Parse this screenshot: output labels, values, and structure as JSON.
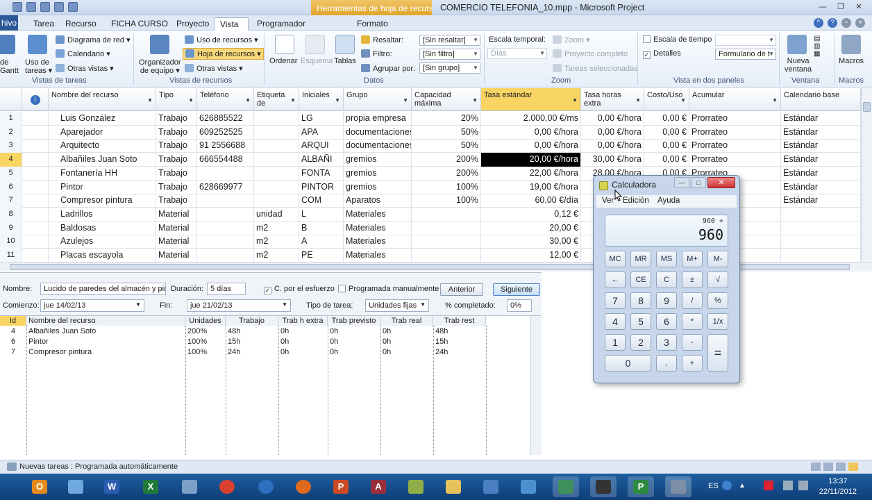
{
  "window": {
    "title": "COMERCIO TELEFONIA_10.mpp - Microsoft Project",
    "context_tab": "Herramientas de hoja de recursos"
  },
  "tabs": [
    "hivo",
    "Tarea",
    "Recurso",
    "FICHA CURSO",
    "Proyecto",
    "Vista",
    "Programador",
    "Formato"
  ],
  "ribbon": {
    "diagrama_red": "Diagrama de red",
    "calendario": "Calendario",
    "otras_vistas": "Otras vistas",
    "diagrama_gantt": "Diagrama de Gantt",
    "diagrama_l1": "de",
    "diagrama_l2": "Gantt",
    "uso_tareas_l1": "Uso de",
    "uso_tareas_l2": "tareas",
    "grp_vistas_tareas": "Vistas de tareas",
    "organizador_l1": "Organizador",
    "organizador_l2": "de equipo",
    "uso_recursos": "Uso de recursos",
    "hoja_recursos": "Hoja de recursos",
    "otras_vistas2": "Otras vistas",
    "grp_vistas_recursos": "Vistas de recursos",
    "ordenar": "Ordenar",
    "esquema": "Esquema",
    "tablas": "Tablas",
    "resaltar": "Resaltar:",
    "resaltar_val": "[Sin resaltar]",
    "filtro": "Filtro:",
    "filtro_val": "[Sin filtro]",
    "agrupar": "Agrupar por:",
    "agrupar_val": "[Sin grupo]",
    "grp_datos": "Datos",
    "escala": "Escala temporal:",
    "escala_val": "Días",
    "zoom": "Zoom",
    "proyecto_completo": "Proyecto completo",
    "tareas_sel": "Tareas seleccionadas",
    "grp_zoom": "Zoom",
    "escala_tiempo": "Escala de tiempo",
    "detalles": "Detalles",
    "formulario": "Formulario de t",
    "grp_dos_paneles": "Vista en dos paneles",
    "nueva_l1": "Nueva",
    "nueva_l2": "ventana",
    "grp_ventana": "Ventana",
    "macros": "Macros",
    "grp_macros": "Macros"
  },
  "columns": [
    "Nombre del recurso",
    "Tipo",
    "Teléfono",
    "Etiqueta de",
    "Iniciales",
    "Grupo",
    "Capacidad máxima",
    "Tasa estándar",
    "Tasa horas extra",
    "Costo/Uso",
    "Acumular",
    "Calendario base"
  ],
  "rows": [
    {
      "n": "1",
      "name": "Luis González",
      "tipo": "Trabajo",
      "tel": "626885522",
      "et": "",
      "ini": "LG",
      "grupo": "propia empresa",
      "cap": "20%",
      "tasa": "2.000,00 €/ms",
      "extra": "0,00 €/hora",
      "costo": "0,00 €",
      "acum": "Prorrateo",
      "cal": "Estándar"
    },
    {
      "n": "2",
      "name": "Aparejador",
      "tipo": "Trabajo",
      "tel": "609252525",
      "et": "",
      "ini": "APA",
      "grupo": "documentaciones",
      "cap": "50%",
      "tasa": "0,00 €/hora",
      "extra": "0,00 €/hora",
      "costo": "0,00 €",
      "acum": "Prorrateo",
      "cal": "Estándar"
    },
    {
      "n": "3",
      "name": "Arquitecto",
      "tipo": "Trabajo",
      "tel": "91 2556688",
      "et": "",
      "ini": "ARQUI",
      "grupo": "documentaciones",
      "cap": "50%",
      "tasa": "0,00 €/hora",
      "extra": "0,00 €/hora",
      "costo": "0,00 €",
      "acum": "Prorrateo",
      "cal": "Estándar"
    },
    {
      "n": "4",
      "name": "Albañiles Juan Soto",
      "tipo": "Trabajo",
      "tel": "666554488",
      "et": "",
      "ini": "ALBAÑI",
      "grupo": "gremios",
      "cap": "200%",
      "tasa": "20,00 €/hora",
      "extra": "30,00 €/hora",
      "costo": "0,00 €",
      "acum": "Prorrateo",
      "cal": "Estándar"
    },
    {
      "n": "5",
      "name": "Fontanería HH",
      "tipo": "Trabajo",
      "tel": "",
      "et": "",
      "ini": "FONTA",
      "grupo": "gremios",
      "cap": "200%",
      "tasa": "22,00 €/hora",
      "extra": "28,00 €/hora",
      "costo": "0,00 €",
      "acum": "Prorrateo",
      "cal": "Estándar"
    },
    {
      "n": "6",
      "name": "Pintor",
      "tipo": "Trabajo",
      "tel": "628669977",
      "et": "",
      "ini": "PINTOR",
      "grupo": "gremios",
      "cap": "100%",
      "tasa": "19,00 €/hora",
      "extra": "",
      "costo": "",
      "acum": "",
      "cal": "Estándar"
    },
    {
      "n": "7",
      "name": "Compresor pintura",
      "tipo": "Trabajo",
      "tel": "",
      "et": "",
      "ini": "COM",
      "grupo": "Aparatos",
      "cap": "100%",
      "tasa": "60,00 €/día",
      "extra": "",
      "costo": "",
      "acum": "",
      "cal": "Estándar"
    },
    {
      "n": "8",
      "name": "Ladrillos",
      "tipo": "Material",
      "tel": "",
      "et": "unidad",
      "ini": "L",
      "grupo": "Materiales",
      "cap": "",
      "tasa": "0,12 €",
      "extra": "",
      "costo": "",
      "acum": "",
      "cal": ""
    },
    {
      "n": "9",
      "name": "Baldosas",
      "tipo": "Material",
      "tel": "",
      "et": "m2",
      "ini": "B",
      "grupo": "Materiales",
      "cap": "",
      "tasa": "20,00 €",
      "extra": "",
      "costo": "",
      "acum": "",
      "cal": ""
    },
    {
      "n": "10",
      "name": "Azulejos",
      "tipo": "Material",
      "tel": "",
      "et": "m2",
      "ini": "A",
      "grupo": "Materiales",
      "cap": "",
      "tasa": "30,00 €",
      "extra": "",
      "costo": "",
      "acum": "",
      "cal": ""
    },
    {
      "n": "11",
      "name": "Placas escayola",
      "tipo": "Material",
      "tel": "",
      "et": "m2",
      "ini": "PE",
      "grupo": "Materiales",
      "cap": "",
      "tasa": "12,00 €",
      "extra": "",
      "costo": "",
      "acum": "",
      "cal": ""
    }
  ],
  "form": {
    "nombre_lbl": "Nombre:",
    "nombre_val": "Lucido de paredes del almacén y pintac",
    "duracion_lbl": "Duración:",
    "duracion_val": "5 días",
    "esfuerzo": "C. por el esfuerzo",
    "manual": "Programada manualmente",
    "anterior": "Anterior",
    "siguiente": "Siguiente",
    "comienzo_lbl": "Comienzo:",
    "comienzo_val": "jue 14/02/13",
    "fin_lbl": "Fin:",
    "fin_val": "jue 21/02/13",
    "tipo_lbl": "Tipo de tarea:",
    "tipo_val": "Unidades fijas",
    "pct_lbl": "% completado:",
    "pct_val": "0%"
  },
  "assign_cols": [
    "Id",
    "Nombre del recurso",
    "Unidades",
    "Trabajo",
    "Trab h extra",
    "Trab previsto",
    "Trab real",
    "Trab rest"
  ],
  "assignments": [
    {
      "id": "4",
      "name": "Albañiles Juan Soto",
      "units": "200%",
      "work": "48h",
      "ext": "0h",
      "prev": "0h",
      "real": "0h",
      "rest": "48h"
    },
    {
      "id": "6",
      "name": "Pintor",
      "units": "100%",
      "work": "15h",
      "ext": "0h",
      "prev": "0h",
      "real": "0h",
      "rest": "15h"
    },
    {
      "id": "7",
      "name": "Compresor pintura",
      "units": "100%",
      "work": "24h",
      "ext": "0h",
      "prev": "0h",
      "real": "0h",
      "rest": "24h"
    }
  ],
  "status": "Nuevas tareas : Programada automáticamente",
  "calculator": {
    "title": "Calculadora",
    "menu": [
      "Ver",
      "Edición",
      "Ayuda"
    ],
    "expr": "960 +",
    "value": "960",
    "keys": [
      [
        "MC",
        "MR",
        "MS",
        "M+",
        "M-"
      ],
      [
        "←",
        "CE",
        "C",
        "±",
        "√"
      ],
      [
        "7",
        "8",
        "9",
        "/",
        "%"
      ],
      [
        "4",
        "5",
        "6",
        "*",
        "1/x"
      ],
      [
        "1",
        "2",
        "3",
        "-",
        "="
      ],
      [
        "0",
        ",",
        "+"
      ]
    ]
  },
  "taskbar": {
    "lang": "ES",
    "time": "13:37",
    "date": "22/11/2012"
  }
}
